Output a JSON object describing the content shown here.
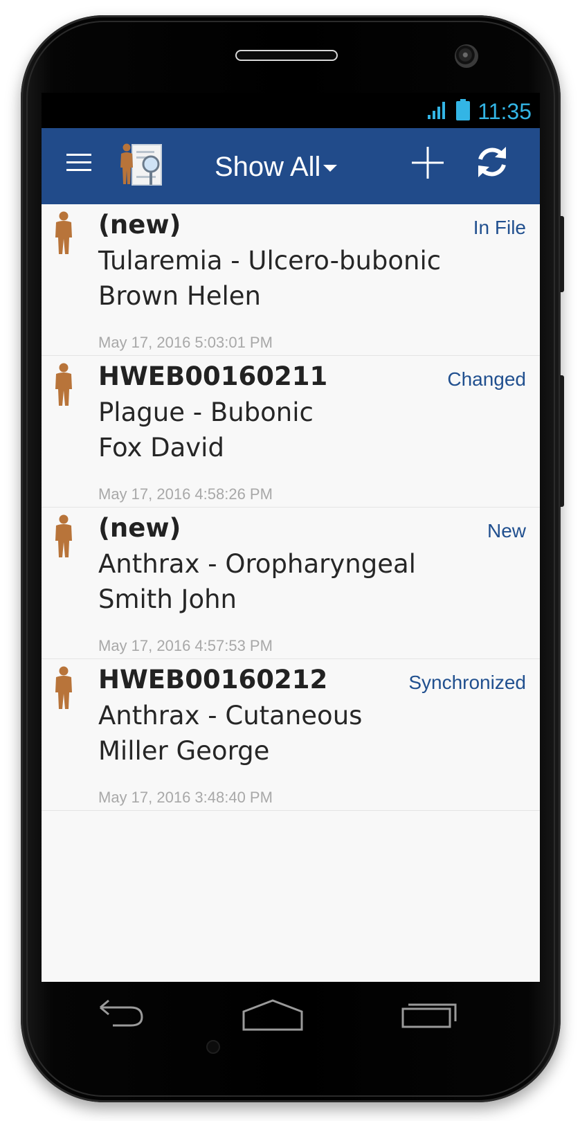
{
  "statusbar": {
    "time": "11:35"
  },
  "appbar": {
    "filter_label": "Show All"
  },
  "items": [
    {
      "title": "(new)",
      "line1": "Tularemia - Ulcero-bubonic",
      "line2": "Brown Helen",
      "date": "May 17, 2016 5:03:01 PM",
      "status": "In File"
    },
    {
      "title": "HWEB00160211",
      "line1": "Plague - Bubonic",
      "line2": "Fox David",
      "date": "May 17, 2016 4:58:26 PM",
      "status": "Changed"
    },
    {
      "title": "(new)",
      "line1": "Anthrax - Oropharyngeal",
      "line2": "Smith John",
      "date": "May 17, 2016 4:57:53 PM",
      "status": "New"
    },
    {
      "title": "HWEB00160212",
      "line1": "Anthrax - Cutaneous",
      "line2": "Miller George",
      "date": "May 17, 2016 3:48:40 PM",
      "status": "Synchronized"
    }
  ],
  "icons": {
    "menu": "menu-icon",
    "app": "case-search-icon",
    "add": "plus-icon",
    "sync": "sync-icon",
    "person": "person-icon",
    "back": "back-icon",
    "home": "home-icon",
    "recents": "recent-apps-icon"
  },
  "colors": {
    "appbar": "#214b8a",
    "status_label": "#21508f",
    "clock": "#33b5e5",
    "person": "#b8743a"
  }
}
